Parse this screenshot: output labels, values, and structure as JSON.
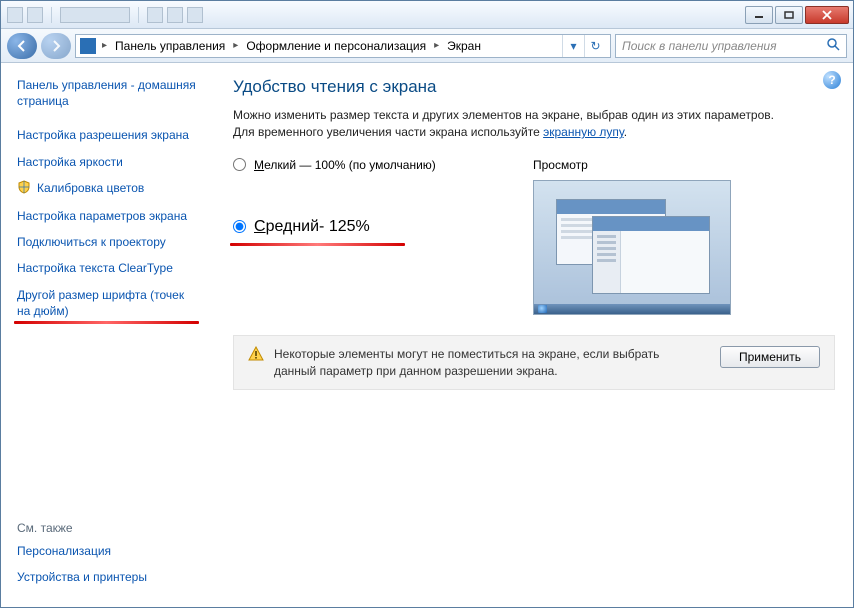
{
  "titlebar": {
    "minimize_tip": "Свернуть",
    "maximize_tip": "Развернуть",
    "close_tip": "Закрыть"
  },
  "nav": {
    "back_tip": "Назад",
    "forward_tip": "Вперёд",
    "crumbs": [
      "Панель управления",
      "Оформление и персонализация",
      "Экран"
    ],
    "search_placeholder": "Поиск в панели управления"
  },
  "sidebar": {
    "home": "Панель управления - домашняя страница",
    "items": [
      "Настройка разрешения экрана",
      "Настройка яркости",
      "Калибровка цветов",
      "Настройка параметров экрана",
      "Подключиться к проектору",
      "Настройка текста ClearType",
      "Другой размер шрифта (точек на дюйм)"
    ],
    "see_also_label": "См. также",
    "see_also": [
      "Персонализация",
      "Устройства и принтеры"
    ]
  },
  "main": {
    "help_tip": "Справка",
    "title": "Удобство чтения с экрана",
    "description_pre": "Можно изменить размер текста и других элементов на экране, выбрав один из этих параметров. Для временного увеличения части экрана используйте ",
    "description_link": "экранную лупу",
    "description_post": ".",
    "option_small_prefix": "М",
    "option_small_rest": "елкий — 100% (по умолчанию)",
    "option_medium_prefix": "С",
    "option_medium_rest": "редний- 125%",
    "selected": "medium",
    "preview_label": "Просмотр",
    "warning": "Некоторые элементы могут не поместиться на экране, если выбрать данный параметр при данном разрешении экрана.",
    "apply_label": "Применить"
  }
}
